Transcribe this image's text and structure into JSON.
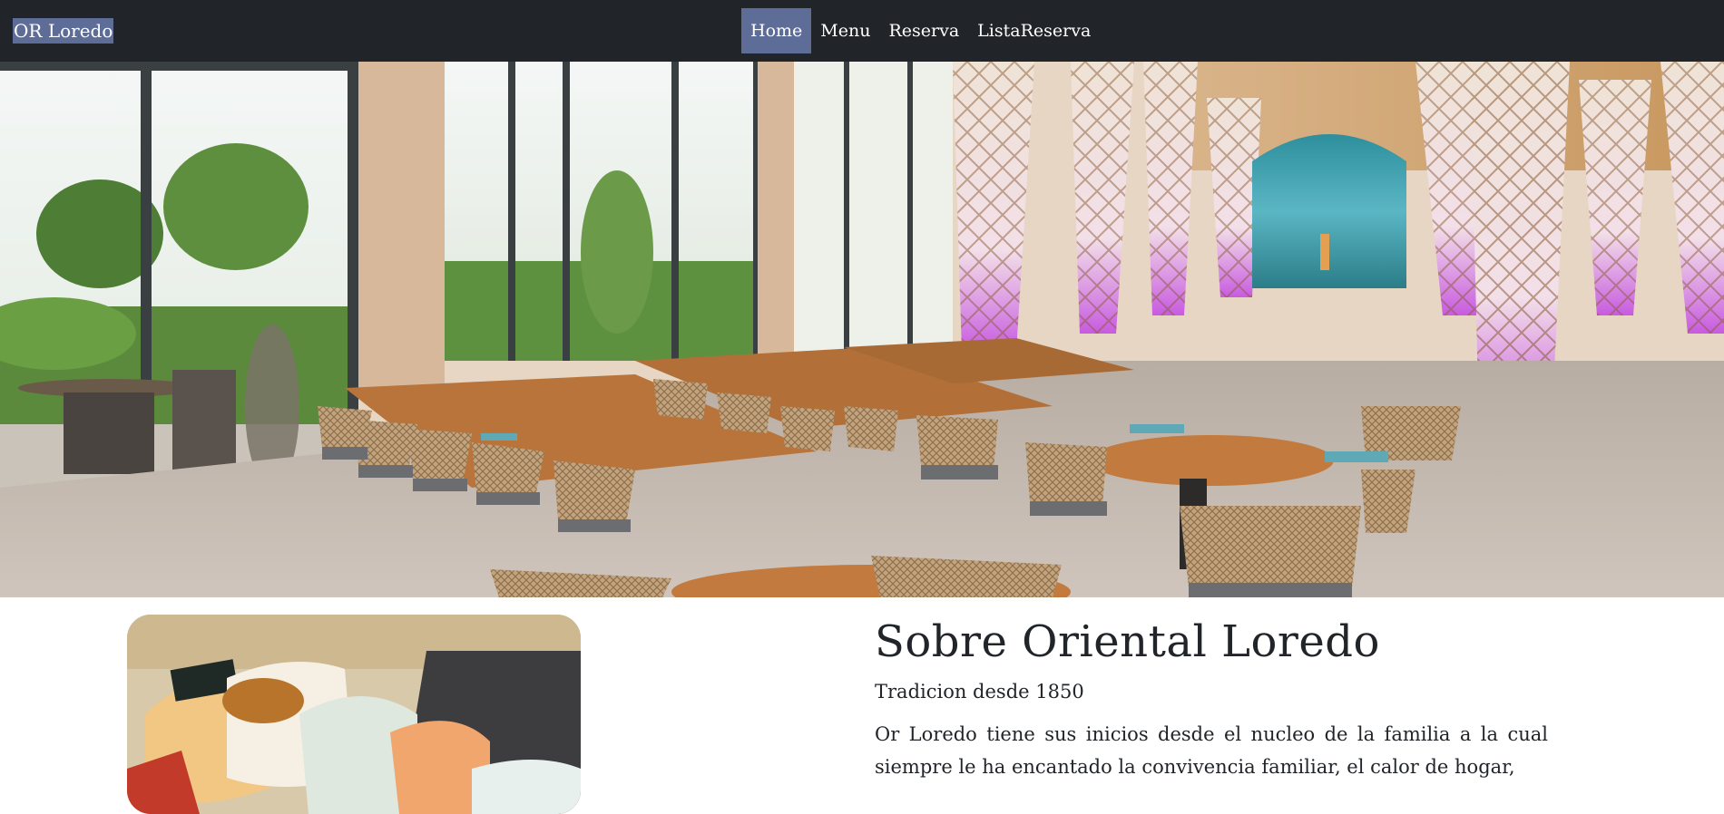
{
  "navbar": {
    "brand": "OR Loredo",
    "links": [
      {
        "label": "Home",
        "active": true
      },
      {
        "label": "Menu",
        "active": false
      },
      {
        "label": "Reserva",
        "active": false
      },
      {
        "label": "ListaReserva",
        "active": false
      }
    ]
  },
  "hero": {
    "image": "restaurant-interior-photo"
  },
  "about": {
    "image": "sushi-photo",
    "title": "Sobre Oriental Loredo",
    "subtitle": "Tradicion desde 1850",
    "body": "Or Loredo tiene sus inicios desde el nucleo de la familia a la cual siempre le ha encantado la convivencia familiar, el calor de hogar,"
  },
  "colors": {
    "navbar_bg": "#212529",
    "active_link_bg": "#5e6d97",
    "accent_purple": "#c85be0"
  }
}
